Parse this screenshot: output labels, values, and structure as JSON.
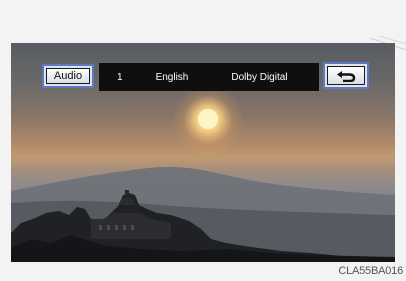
{
  "controls": {
    "audio_button": "Audio",
    "back_icon": "back-arrow-icon"
  },
  "osd": {
    "track_number": "1",
    "language": "English",
    "audio_format": "Dolby Digital"
  },
  "figure_caption": "CLA55BA016",
  "colors": {
    "button_border": "#5d79c6",
    "osd_background": "#0f0f0f"
  }
}
